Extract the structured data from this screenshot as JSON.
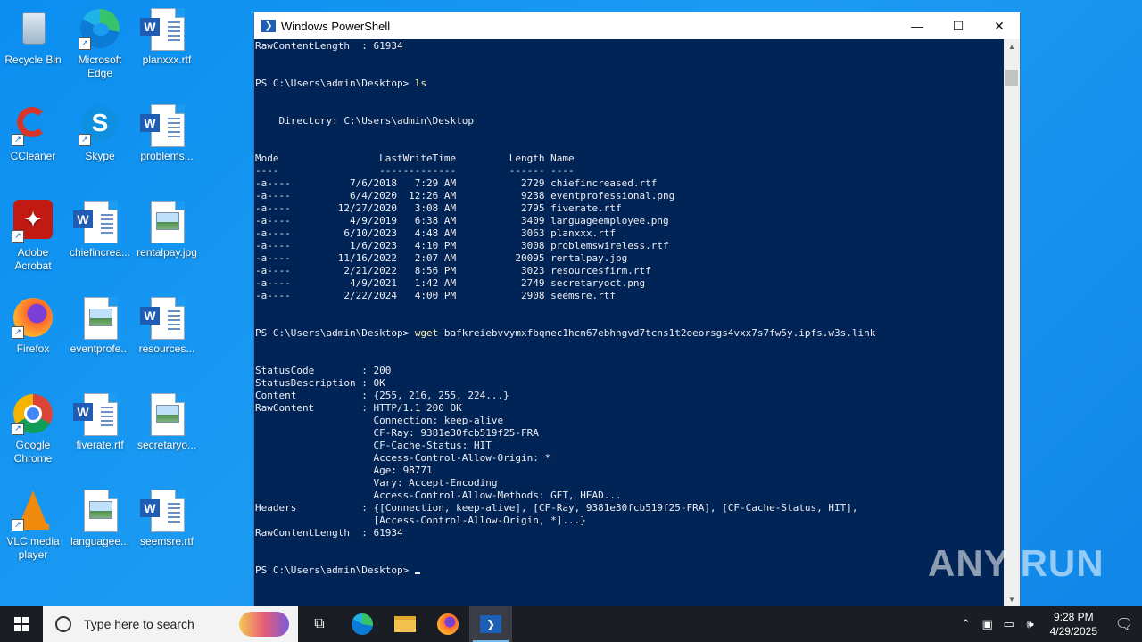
{
  "desktop": {
    "icons": [
      {
        "label": "Recycle Bin",
        "icon": "recycle-bin-icon"
      },
      {
        "label": "Microsoft Edge",
        "icon": "edge-icon"
      },
      {
        "label": "planxxx.rtf",
        "icon": "word-document-icon"
      },
      {
        "label": "CCleaner",
        "icon": "ccleaner-icon"
      },
      {
        "label": "Skype",
        "icon": "skype-icon"
      },
      {
        "label": "problems...",
        "icon": "word-document-icon"
      },
      {
        "label": "Adobe Acrobat",
        "icon": "acrobat-icon"
      },
      {
        "label": "chiefincrea...",
        "icon": "word-document-icon"
      },
      {
        "label": "rentalpay.jpg",
        "icon": "image-file-icon"
      },
      {
        "label": "Firefox",
        "icon": "firefox-icon"
      },
      {
        "label": "eventprofe...",
        "icon": "image-file-icon"
      },
      {
        "label": "resources...",
        "icon": "word-document-icon"
      },
      {
        "label": "Google Chrome",
        "icon": "chrome-icon"
      },
      {
        "label": "fiverate.rtf",
        "icon": "word-document-icon"
      },
      {
        "label": "secretaryo...",
        "icon": "image-file-icon"
      },
      {
        "label": "VLC media player",
        "icon": "vlc-icon"
      },
      {
        "label": "languagee...",
        "icon": "image-file-icon"
      },
      {
        "label": "seemsre.rtf",
        "icon": "word-document-icon"
      }
    ]
  },
  "window": {
    "title": "Windows PowerShell",
    "minimize": "—",
    "maximize": "☐",
    "close": "✕"
  },
  "console": {
    "line_top": "RawContentLength  : 61934",
    "prompt1": "PS C:\\Users\\admin\\Desktop> ",
    "cmd1": "ls",
    "directory_line": "    Directory: C:\\Users\\admin\\Desktop",
    "table_header": "Mode                 LastWriteTime         Length Name",
    "table_rule": "----                 -------------         ------ ----",
    "rows": [
      "-a----          7/6/2018   7:29 AM           2729 chiefincreased.rtf",
      "-a----          6/4/2020  12:26 AM           9238 eventprofessional.png",
      "-a----        12/27/2020   3:08 AM           2795 fiverate.rtf",
      "-a----          4/9/2019   6:38 AM           3409 languageemployee.png",
      "-a----         6/10/2023   4:48 AM           3063 planxxx.rtf",
      "-a----          1/6/2023   4:10 PM           3008 problemswireless.rtf",
      "-a----        11/16/2022   2:07 AM          20095 rentalpay.jpg",
      "-a----         2/21/2022   8:56 PM           3023 resourcesfirm.rtf",
      "-a----          4/9/2021   1:42 AM           2749 secretaryoct.png",
      "-a----         2/22/2024   4:00 PM           2908 seemsre.rtf"
    ],
    "prompt2": "PS C:\\Users\\admin\\Desktop> ",
    "cmd2_verb": "wget",
    "cmd2_arg": " bafkreiebvvymxfbqnec1hcn67ebhhgvd7tcns1t2oeorsgs4vxx7s7fw5y.ipfs.w3s.link",
    "response": [
      "StatusCode        : 200",
      "StatusDescription : OK",
      "Content           : {255, 216, 255, 224...}",
      "RawContent        : HTTP/1.1 200 OK",
      "                    Connection: keep-alive",
      "                    CF-Ray: 9381e30fcb519f25-FRA",
      "                    CF-Cache-Status: HIT",
      "                    Access-Control-Allow-Origin: *",
      "                    Age: 98771",
      "                    Vary: Accept-Encoding",
      "                    Access-Control-Allow-Methods: GET, HEAD...",
      "Headers           : {[Connection, keep-alive], [CF-Ray, 9381e30fcb519f25-FRA], [CF-Cache-Status, HIT],",
      "                    [Access-Control-Allow-Origin, *]...}",
      "RawContentLength  : 61934"
    ],
    "prompt3": "PS C:\\Users\\admin\\Desktop> "
  },
  "watermark": "ANY RUN",
  "taskbar": {
    "search_placeholder": "Type here to search",
    "apps": [
      "task-view-icon",
      "edge-icon",
      "file-explorer-icon",
      "firefox-icon",
      "powershell-icon"
    ],
    "time": "9:28 PM",
    "date": "4/29/2025"
  },
  "colors": {
    "console_bg": "#012456",
    "prompt_command": "#f9f1a5",
    "desktop_bg": "#1c9bf2",
    "taskbar_bg": "#1b1d24"
  }
}
